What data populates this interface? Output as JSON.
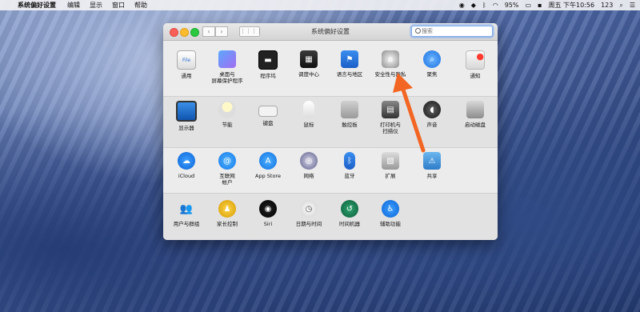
{
  "menubar": {
    "app_name": "系统偏好设置",
    "menus": [
      "编辑",
      "显示",
      "窗口",
      "帮助"
    ],
    "battery": "95%",
    "clock": "周五 下午10:56",
    "input_source": "123"
  },
  "window": {
    "title": "系统偏好设置",
    "search_placeholder": "搜索"
  },
  "rows": [
    [
      {
        "label": "通用",
        "icon": "general-icon"
      },
      {
        "label": "桌面与\n屏幕保护程序",
        "icon": "desktop-icon"
      },
      {
        "label": "程序坞",
        "icon": "dock-icon"
      },
      {
        "label": "调度中心",
        "icon": "mission-control-icon"
      },
      {
        "label": "语言与地区",
        "icon": "language-icon"
      },
      {
        "label": "安全性与隐私",
        "icon": "security-icon"
      },
      {
        "label": "聚焦",
        "icon": "spotlight-icon"
      },
      {
        "label": "通知",
        "icon": "notifications-icon"
      }
    ],
    [
      {
        "label": "显示器",
        "icon": "display-icon"
      },
      {
        "label": "节能",
        "icon": "energy-icon"
      },
      {
        "label": "键盘",
        "icon": "keyboard-icon"
      },
      {
        "label": "鼠标",
        "icon": "mouse-icon"
      },
      {
        "label": "触控板",
        "icon": "trackpad-icon"
      },
      {
        "label": "打印机与\n扫描仪",
        "icon": "printer-icon"
      },
      {
        "label": "声音",
        "icon": "sound-icon"
      },
      {
        "label": "启动磁盘",
        "icon": "startup-disk-icon"
      }
    ],
    [
      {
        "label": "iCloud",
        "icon": "icloud-icon"
      },
      {
        "label": "互联网\n帐户",
        "icon": "internet-accounts-icon"
      },
      {
        "label": "App Store",
        "icon": "app-store-icon"
      },
      {
        "label": "网络",
        "icon": "network-icon"
      },
      {
        "label": "蓝牙",
        "icon": "bluetooth-icon"
      },
      {
        "label": "扩展",
        "icon": "extensions-icon"
      },
      {
        "label": "共享",
        "icon": "sharing-icon"
      }
    ],
    [
      {
        "label": "用户与群组",
        "icon": "users-icon"
      },
      {
        "label": "家长控制",
        "icon": "parental-controls-icon"
      },
      {
        "label": "Siri",
        "icon": "siri-icon"
      },
      {
        "label": "日期与时间",
        "icon": "date-time-icon"
      },
      {
        "label": "时间机器",
        "icon": "time-machine-icon"
      },
      {
        "label": "辅助功能",
        "icon": "accessibility-icon"
      }
    ]
  ],
  "accent_color": "#f26522"
}
